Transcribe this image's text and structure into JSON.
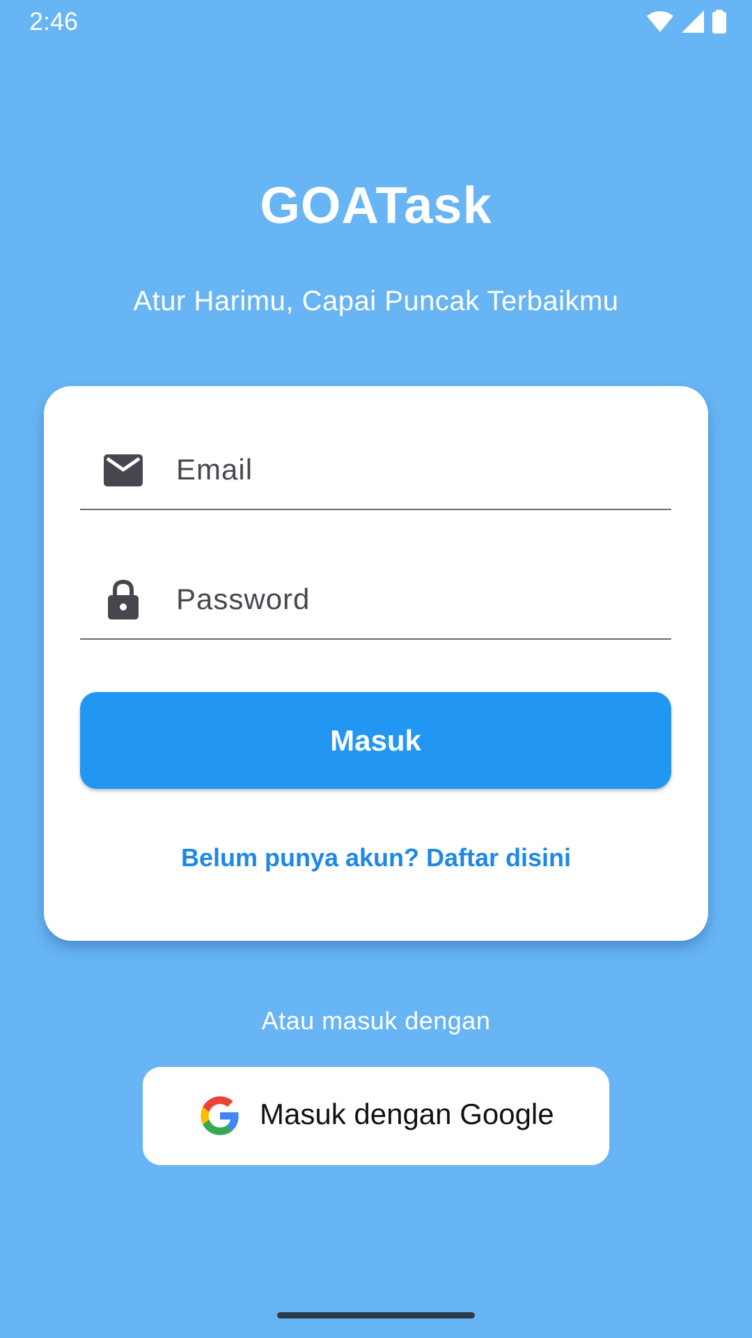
{
  "status_bar": {
    "time": "2:46",
    "icons": [
      "wifi-icon",
      "cellular-signal-icon",
      "battery-icon"
    ]
  },
  "app": {
    "title": "GOATask",
    "subtitle": "Atur Harimu, Capai Puncak Terbaikmu"
  },
  "login_form": {
    "email": {
      "icon": "email-icon",
      "placeholder": "Email",
      "value": ""
    },
    "password": {
      "icon": "lock-icon",
      "placeholder": "Password",
      "value": ""
    },
    "submit_label": "Masuk",
    "register_link": "Belum punya akun? Daftar disini"
  },
  "alt_login": {
    "divider_text": "Atau masuk dengan",
    "google_button_label": "Masuk dengan Google",
    "google_icon": "google-icon"
  },
  "colors": {
    "background": "#67b5f5",
    "primary": "#2196f3",
    "link": "#1e88e5",
    "card": "#ffffff"
  }
}
